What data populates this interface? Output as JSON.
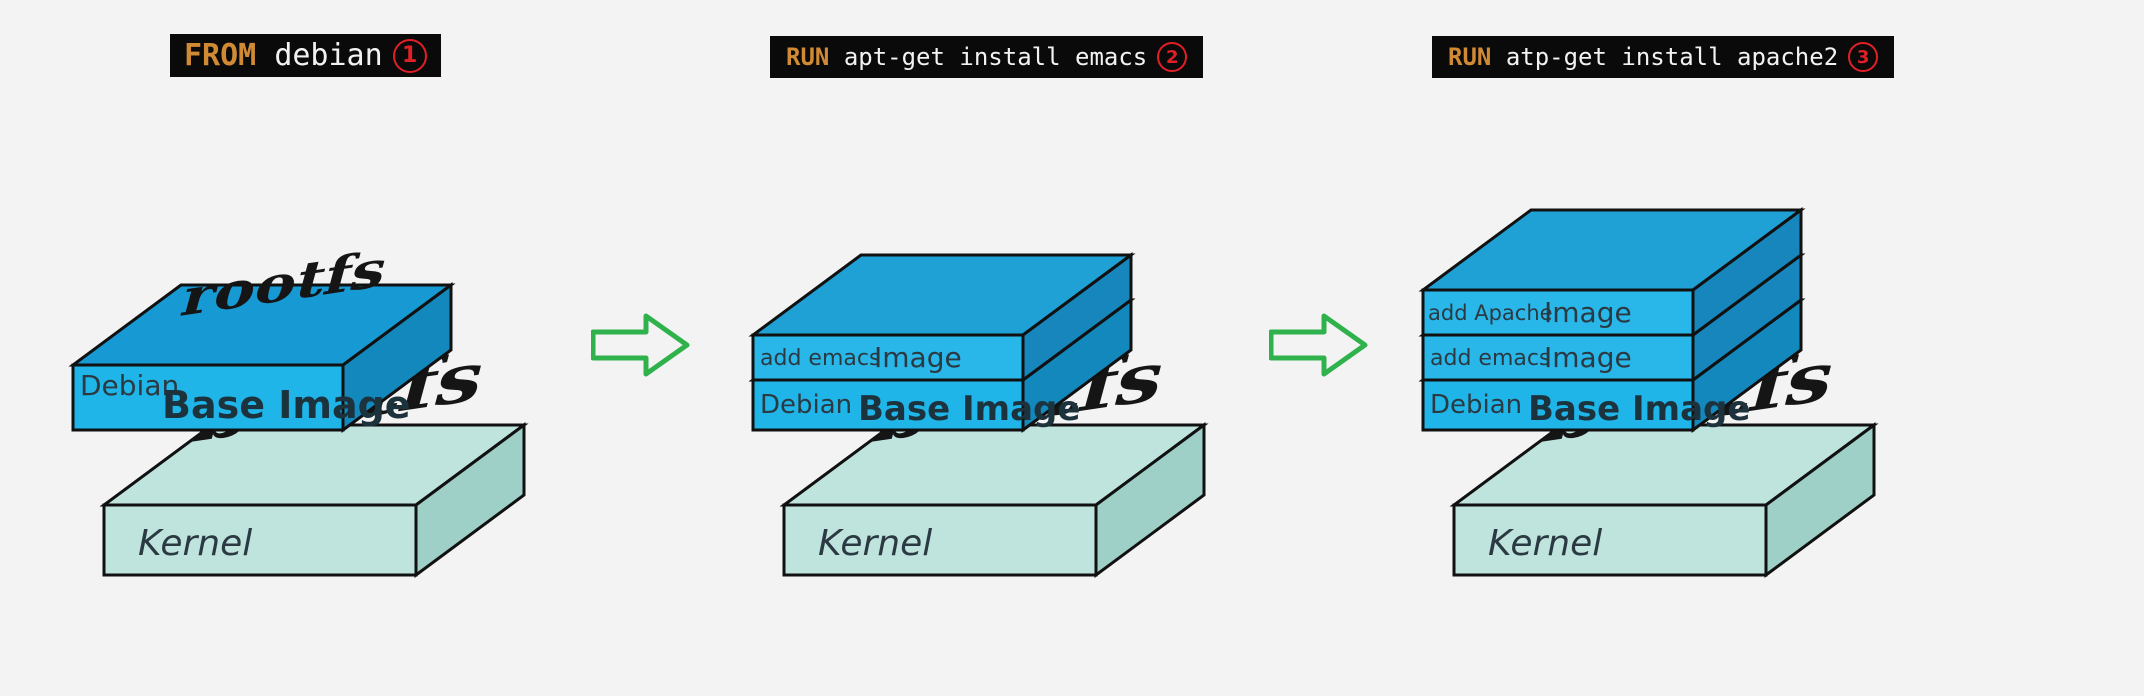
{
  "colors": {
    "bg": "#f4f3f3",
    "cmd_bg": "#0a0a0a",
    "cmd_keyword": "#d08a34",
    "cmd_args": "#f2f2f2",
    "step_circle": "#e11f27",
    "arrow": "#2fb24c",
    "kernel_top": "#bfe4de",
    "kernel_front": "#bfe4de",
    "kernel_side": "#9ed0c8",
    "debian_top": "#179ad4",
    "debian_front": "#1fb5e8",
    "debian_side": "#1388bd",
    "image_top": "#1fa1d6",
    "image_front": "#29b6e9",
    "image_side": "#1686bd",
    "stroke": "#111111"
  },
  "steps": [
    {
      "keyword": "FROM",
      "args": "debian",
      "number": "1"
    },
    {
      "keyword": "RUN",
      "args": "apt-get install emacs",
      "number": "2"
    },
    {
      "keyword": "RUN",
      "args": "atp-get install apache2",
      "number": "3"
    }
  ],
  "labels": {
    "rootfs": "rootfs",
    "bootfs": "bootfs",
    "debian_side": "Debian",
    "base_image": "Base Image",
    "kernel": "Kernel",
    "add_emacs": "add emacs",
    "add_apache": "add Apache",
    "image": "Image"
  }
}
